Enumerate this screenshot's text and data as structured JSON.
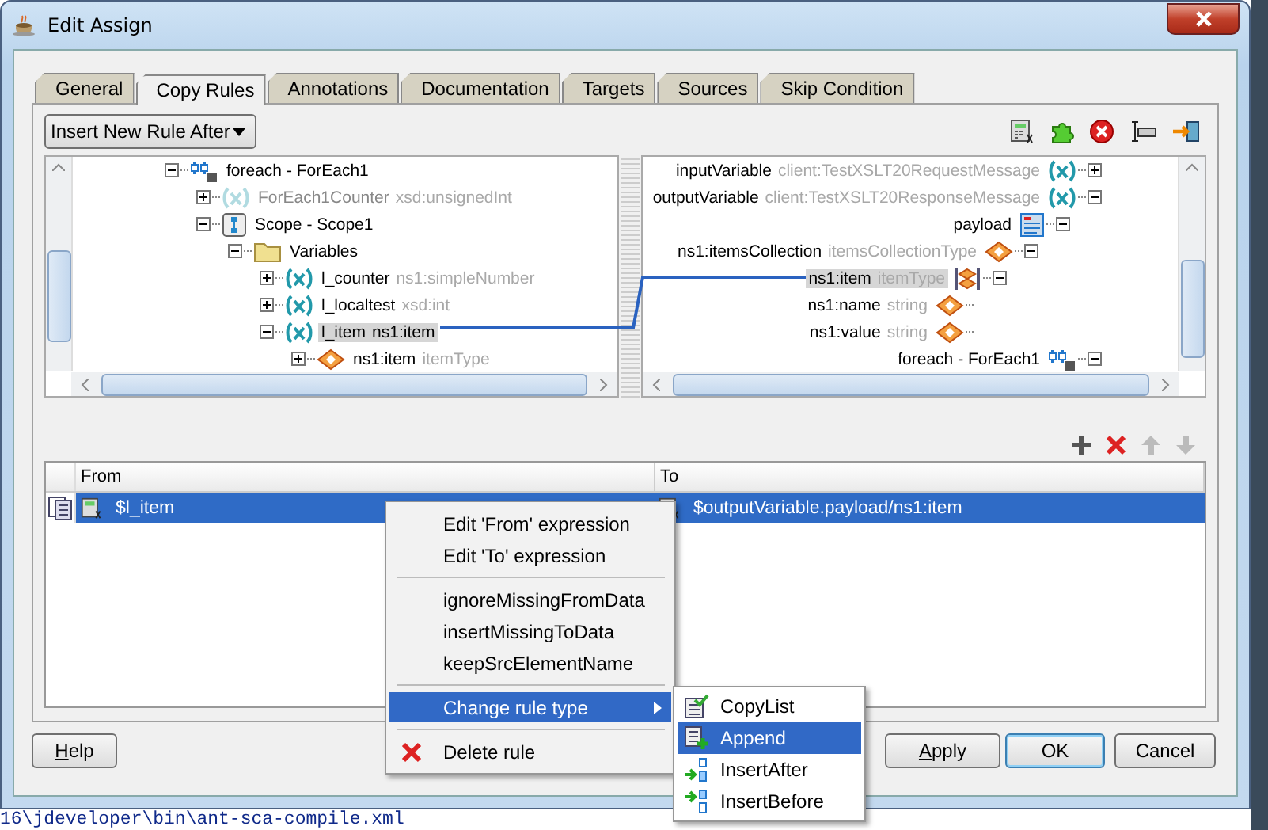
{
  "window": {
    "title": "Edit Assign"
  },
  "tabs": [
    {
      "label": "General",
      "selected": false
    },
    {
      "label": "Copy Rules",
      "selected": true
    },
    {
      "label": "Annotations",
      "selected": false
    },
    {
      "label": "Documentation",
      "selected": false
    },
    {
      "label": "Targets",
      "selected": false
    },
    {
      "label": "Sources",
      "selected": false
    },
    {
      "label": "Skip Condition",
      "selected": false
    }
  ],
  "rule_position": {
    "value": "Insert New Rule After"
  },
  "source_tree": [
    {
      "label": "foreach - ForEach1",
      "kind": "foreach",
      "expanded": true,
      "selected": false,
      "disabled": false,
      "children": [
        {
          "label": "ForEach1Counter",
          "type": "xsd:unsignedInt",
          "kind": "variable",
          "expanded": false,
          "selected": false,
          "disabled": true
        },
        {
          "label": "Scope - Scope1",
          "kind": "scope",
          "expanded": true,
          "selected": false,
          "disabled": false,
          "children": [
            {
              "label": "Variables",
              "kind": "folder",
              "expanded": true,
              "selected": false,
              "disabled": false,
              "children": [
                {
                  "label": "l_counter",
                  "type": "ns1:simpleNumber",
                  "kind": "variable",
                  "expanded": false,
                  "selected": false,
                  "disabled": false
                },
                {
                  "label": "l_localtest",
                  "type": "xsd:int",
                  "kind": "variable",
                  "expanded": false,
                  "selected": false,
                  "disabled": false
                },
                {
                  "label": "l_item",
                  "type": "ns1:item",
                  "kind": "variable",
                  "expanded": true,
                  "selected": true,
                  "disabled": false,
                  "children": [
                    {
                      "label": "ns1:item",
                      "type": "itemType",
                      "kind": "element",
                      "expanded": false,
                      "selected": false,
                      "disabled": false
                    }
                  ]
                }
              ]
            }
          ]
        }
      ]
    }
  ],
  "target_tree": [
    {
      "label": "inputVariable",
      "type": "client:TestXSLT20RequestMessage",
      "kind": "variable",
      "expanded": false,
      "selected": false
    },
    {
      "label": "outputVariable",
      "type": "client:TestXSLT20ResponseMessage",
      "kind": "variable",
      "expanded": true,
      "selected": false,
      "children": [
        {
          "label": "payload",
          "kind": "message",
          "expanded": true,
          "selected": false,
          "children": [
            {
              "label": "ns1:itemsCollection",
              "type": "itemsCollectionType",
              "kind": "element",
              "expanded": true,
              "selected": false,
              "children": [
                {
                  "label": "ns1:item",
                  "type": "itemType",
                  "kind": "element-list",
                  "expanded": true,
                  "selected": true,
                  "children": [
                    {
                      "label": "ns1:name",
                      "type": "string",
                      "kind": "element",
                      "selected": false
                    },
                    {
                      "label": "ns1:value",
                      "type": "string",
                      "kind": "element",
                      "selected": false
                    }
                  ]
                }
              ]
            }
          ]
        }
      ]
    },
    {
      "label": "foreach - ForEach1",
      "kind": "foreach",
      "expanded": true,
      "selected": false
    }
  ],
  "table": {
    "columns": [
      "From",
      "To"
    ],
    "rows": [
      {
        "from": "$l_item",
        "to": "$outputVariable.payload/ns1:item",
        "selected": true
      }
    ]
  },
  "context_menu": [
    {
      "kind": "item",
      "label": "Edit 'From' expression",
      "selected": false
    },
    {
      "kind": "item",
      "label": "Edit 'To' expression",
      "selected": false
    },
    {
      "kind": "separator"
    },
    {
      "kind": "item",
      "label": "ignoreMissingFromData",
      "selected": false
    },
    {
      "kind": "item",
      "label": "insertMissingToData",
      "selected": false
    },
    {
      "kind": "item",
      "label": "keepSrcElementName",
      "selected": false
    },
    {
      "kind": "separator"
    },
    {
      "kind": "submenu",
      "label": "Change rule type",
      "selected": true
    },
    {
      "kind": "separator"
    },
    {
      "kind": "delete",
      "label": "Delete rule",
      "selected": false
    }
  ],
  "submenu": [
    {
      "kind": "copylist",
      "label": "CopyList",
      "selected": false
    },
    {
      "kind": "append",
      "label": "Append",
      "selected": true
    },
    {
      "kind": "insert-after",
      "label": "InsertAfter",
      "selected": false
    },
    {
      "kind": "insert-before",
      "label": "InsertBefore",
      "selected": false
    }
  ],
  "buttons": [
    {
      "label": "Help",
      "mnemonic": true,
      "default": false
    },
    {
      "label": "Apply",
      "mnemonic": true,
      "default": false
    },
    {
      "label": "OK",
      "mnemonic": false,
      "default": true
    },
    {
      "label": "Cancel",
      "mnemonic": false,
      "default": false
    }
  ],
  "console": {
    "text": "16\\jdeveloper\\bin\\ant-sca-compile.xml"
  }
}
